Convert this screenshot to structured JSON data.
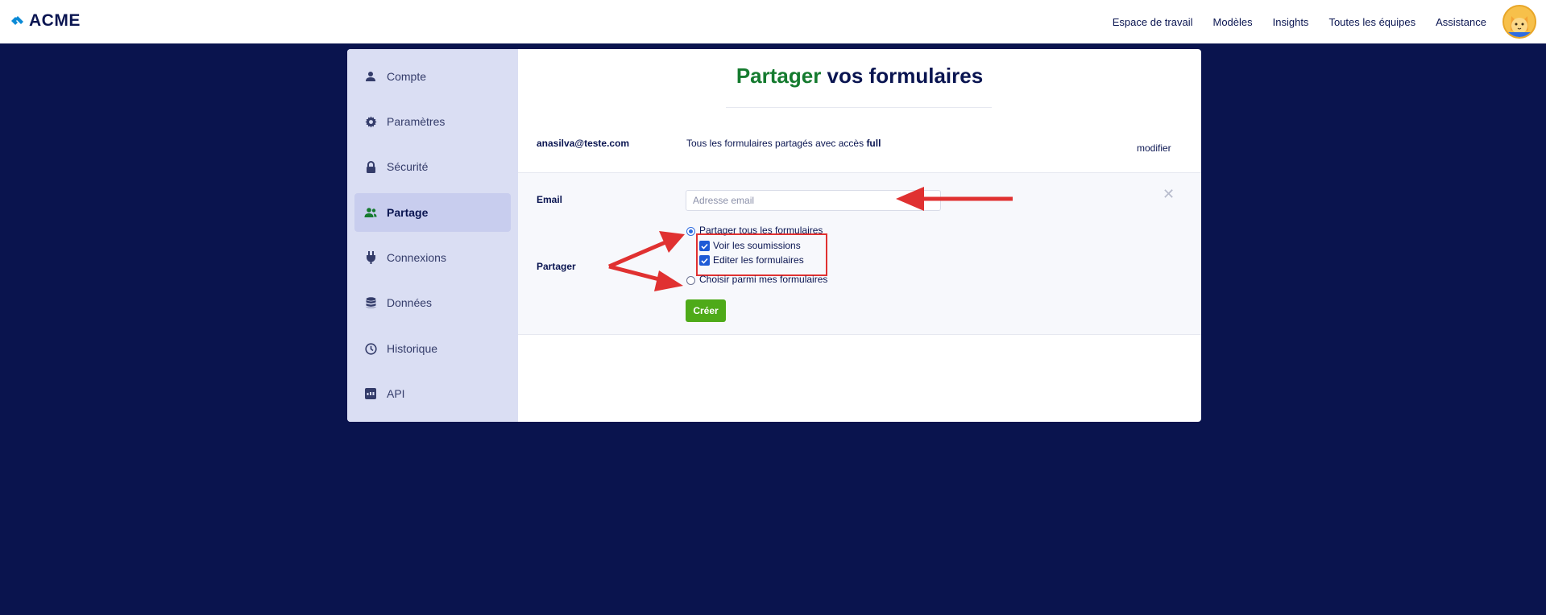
{
  "brand": {
    "name": "ACME"
  },
  "nav": {
    "items": [
      "Espace de travail",
      "Modèles",
      "Insights",
      "Toutes les équipes",
      "Assistance"
    ]
  },
  "sidebar": {
    "items": [
      {
        "label": "Compte",
        "icon": "user-icon"
      },
      {
        "label": "Paramètres",
        "icon": "gear-icon"
      },
      {
        "label": "Sécurité",
        "icon": "lock-icon"
      },
      {
        "label": "Partage",
        "icon": "users-icon",
        "active": true
      },
      {
        "label": "Connexions",
        "icon": "plug-icon"
      },
      {
        "label": "Données",
        "icon": "database-icon"
      },
      {
        "label": "Historique",
        "icon": "history-icon"
      },
      {
        "label": "API",
        "icon": "api-icon"
      }
    ]
  },
  "page": {
    "title_highlight": "Partager",
    "title_rest": " vos formulaires"
  },
  "share_row": {
    "email": "anasilva@teste.com",
    "desc_prefix": "Tous les formulaires partagés avec accès ",
    "desc_access": "full",
    "edit_label": "modifier"
  },
  "form": {
    "email_label": "Email",
    "email_placeholder": "Adresse email",
    "email_value": "",
    "close_symbol": "✕",
    "share_label": "Partager",
    "option_all": "Partager tous les formulaires",
    "option_choose": "Choisir parmi mes formulaires",
    "checkbox_view": "Voir les soumissions",
    "checkbox_edit": "Editer les formulaires",
    "create_label": "Créer"
  },
  "colors": {
    "background": "#0a144e",
    "accent_green": "#157b2f",
    "button_green": "#4eaa19",
    "annotation_red": "#e03131",
    "checkbox_blue": "#1e5ad6"
  }
}
